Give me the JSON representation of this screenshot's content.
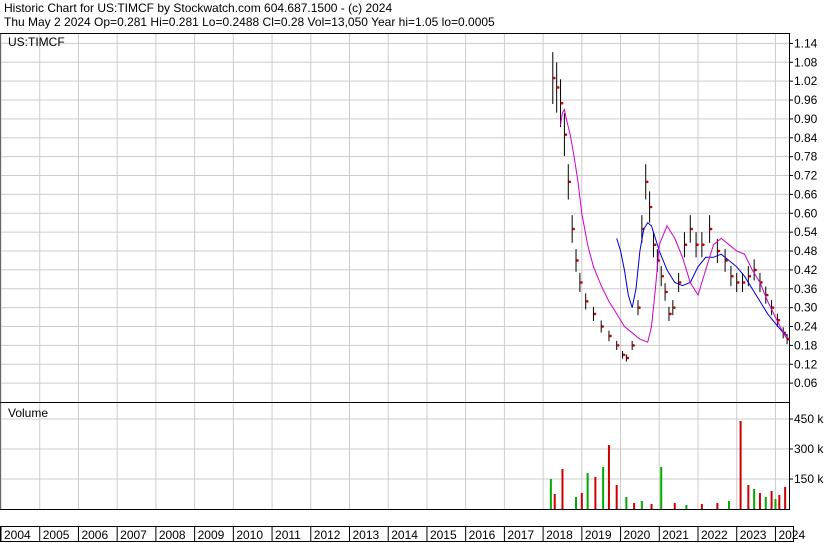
{
  "header": {
    "line1": "Historic Chart for US:TIMCF by Stockwatch.com 604.687.1500 - (c) 2024",
    "line2": "Thu May  2 2024   Op=0.281   Hi=0.281   Lo=0.2488   Cl=0.28   Vol=13,050   Year hi=1.05   lo=0.0005"
  },
  "colors": {
    "price_bar": "#000000",
    "price_dot": "#cc0000",
    "ma_short": "#0000cc",
    "ma_long": "#cc00cc",
    "volume_up": "#00aa00",
    "volume_down": "#cc0000",
    "grid": "#cccccc"
  },
  "chart_data": [
    {
      "type": "line",
      "title": "US:TIMCF",
      "ylim": [
        0,
        1.17
      ],
      "y_axis_side": "right",
      "grid": true,
      "y_ticks": [
        "1.14",
        "1.08",
        "1.02",
        "0.96",
        "0.90",
        "0.84",
        "0.78",
        "0.72",
        "0.66",
        "0.60",
        "0.54",
        "0.48",
        "0.42",
        "0.36",
        "0.30",
        "0.24",
        "0.18",
        "0.12",
        "0.06"
      ],
      "x_ticks": [
        "2004",
        "2005",
        "2006",
        "2007",
        "2008",
        "2009",
        "2010",
        "2011",
        "2012",
        "2013",
        "2014",
        "2015",
        "2016",
        "2017",
        "2018",
        "2019",
        "2020",
        "2021",
        "2022",
        "2023",
        "2024"
      ],
      "series": [
        {
          "role": "price",
          "x": [
            2018.25,
            2018.35,
            2018.45,
            2018.55,
            2018.65,
            2018.75,
            2018.85,
            2018.95,
            2019.1,
            2019.3,
            2019.5,
            2019.7,
            2019.9,
            2020.05,
            2020.15,
            2020.3,
            2020.45,
            2020.55,
            2020.65,
            2020.75,
            2020.85,
            2020.95,
            2021.05,
            2021.15,
            2021.25,
            2021.35,
            2021.5,
            2021.65,
            2021.8,
            2021.95,
            2022.1,
            2022.3,
            2022.5,
            2022.7,
            2022.85,
            2023.0,
            2023.15,
            2023.3,
            2023.45,
            2023.6,
            2023.75,
            2023.9,
            2024.05,
            2024.2,
            2024.3
          ],
          "values": [
            1.03,
            1.0,
            0.95,
            0.85,
            0.7,
            0.55,
            0.45,
            0.38,
            0.32,
            0.28,
            0.24,
            0.21,
            0.18,
            0.15,
            0.14,
            0.18,
            0.3,
            0.55,
            0.7,
            0.62,
            0.5,
            0.45,
            0.4,
            0.35,
            0.28,
            0.3,
            0.38,
            0.5,
            0.55,
            0.5,
            0.5,
            0.55,
            0.48,
            0.45,
            0.4,
            0.38,
            0.38,
            0.4,
            0.42,
            0.38,
            0.34,
            0.3,
            0.26,
            0.22,
            0.2
          ]
        },
        {
          "name": "",
          "role": "moving average (short)",
          "x": [
            2019.9,
            2020.0,
            2020.1,
            2020.2,
            2020.3,
            2020.4,
            2020.5,
            2020.6,
            2020.7,
            2020.8,
            2020.9,
            2021.0,
            2021.2,
            2021.4,
            2021.6,
            2021.8,
            2022.0,
            2022.2,
            2022.4,
            2022.6,
            2022.8,
            2023.0,
            2023.2,
            2023.4,
            2023.6,
            2023.8,
            2024.0,
            2024.2,
            2024.3
          ],
          "values": [
            0.52,
            0.48,
            0.42,
            0.34,
            0.3,
            0.36,
            0.48,
            0.55,
            0.57,
            0.56,
            0.52,
            0.48,
            0.42,
            0.38,
            0.37,
            0.38,
            0.43,
            0.46,
            0.46,
            0.47,
            0.45,
            0.43,
            0.4,
            0.36,
            0.32,
            0.28,
            0.25,
            0.22,
            0.21
          ]
        },
        {
          "name": "",
          "role": "moving average (long)",
          "x": [
            2018.45,
            2018.5,
            2018.55,
            2018.6,
            2018.7,
            2018.8,
            2018.9,
            2019.0,
            2019.15,
            2019.3,
            2019.5,
            2019.7,
            2019.9,
            2020.1,
            2020.3,
            2020.5,
            2020.7,
            2020.8,
            2020.9,
            2021.0,
            2021.2,
            2021.4,
            2021.6,
            2021.8,
            2022.0,
            2022.2,
            2022.4,
            2022.6,
            2022.8,
            2023.0,
            2023.2,
            2023.4,
            2023.6,
            2023.8,
            2024.0,
            2024.2,
            2024.3
          ],
          "values": [
            0.88,
            0.92,
            0.93,
            0.9,
            0.85,
            0.78,
            0.7,
            0.6,
            0.5,
            0.43,
            0.37,
            0.32,
            0.28,
            0.24,
            0.22,
            0.2,
            0.19,
            0.24,
            0.36,
            0.5,
            0.56,
            0.52,
            0.46,
            0.38,
            0.34,
            0.42,
            0.5,
            0.52,
            0.5,
            0.48,
            0.47,
            0.42,
            0.38,
            0.32,
            0.27,
            0.22,
            0.2
          ]
        }
      ]
    },
    {
      "type": "bar",
      "title": "Volume",
      "ylim": [
        0,
        500
      ],
      "y_axis_side": "right",
      "grid": true,
      "y_ticks": [
        "450 k",
        "300 k",
        "150 k"
      ],
      "bars": [
        {
          "x": 2018.2,
          "value": 150,
          "color": "#00aa00"
        },
        {
          "x": 2018.3,
          "value": 75,
          "color": "#cc0000"
        },
        {
          "x": 2018.5,
          "value": 200,
          "color": "#cc0000"
        },
        {
          "x": 2018.85,
          "value": 60,
          "color": "#00aa00"
        },
        {
          "x": 2019.0,
          "value": 80,
          "color": "#cc0000"
        },
        {
          "x": 2019.15,
          "value": 180,
          "color": "#00aa00"
        },
        {
          "x": 2019.35,
          "value": 160,
          "color": "#cc0000"
        },
        {
          "x": 2019.55,
          "value": 210,
          "color": "#00aa00"
        },
        {
          "x": 2019.7,
          "value": 320,
          "color": "#cc0000"
        },
        {
          "x": 2019.9,
          "value": 120,
          "color": "#cc0000"
        },
        {
          "x": 2020.15,
          "value": 60,
          "color": "#00aa00"
        },
        {
          "x": 2020.35,
          "value": 30,
          "color": "#cc0000"
        },
        {
          "x": 2020.55,
          "value": 40,
          "color": "#00aa00"
        },
        {
          "x": 2020.8,
          "value": 25,
          "color": "#cc0000"
        },
        {
          "x": 2021.05,
          "value": 210,
          "color": "#00aa00"
        },
        {
          "x": 2021.4,
          "value": 30,
          "color": "#cc0000"
        },
        {
          "x": 2021.7,
          "value": 20,
          "color": "#00aa00"
        },
        {
          "x": 2022.1,
          "value": 25,
          "color": "#cc0000"
        },
        {
          "x": 2022.5,
          "value": 30,
          "color": "#cc0000"
        },
        {
          "x": 2022.8,
          "value": 40,
          "color": "#00aa00"
        },
        {
          "x": 2023.1,
          "value": 440,
          "color": "#cc0000"
        },
        {
          "x": 2023.3,
          "value": 120,
          "color": "#cc0000"
        },
        {
          "x": 2023.45,
          "value": 100,
          "color": "#00aa00"
        },
        {
          "x": 2023.6,
          "value": 80,
          "color": "#cc0000"
        },
        {
          "x": 2023.75,
          "value": 60,
          "color": "#00aa00"
        },
        {
          "x": 2023.9,
          "value": 90,
          "color": "#cc0000"
        },
        {
          "x": 2024.0,
          "value": 50,
          "color": "#00aa00"
        },
        {
          "x": 2024.1,
          "value": 70,
          "color": "#cc0000"
        },
        {
          "x": 2024.25,
          "value": 110,
          "color": "#cc0000"
        }
      ]
    }
  ]
}
